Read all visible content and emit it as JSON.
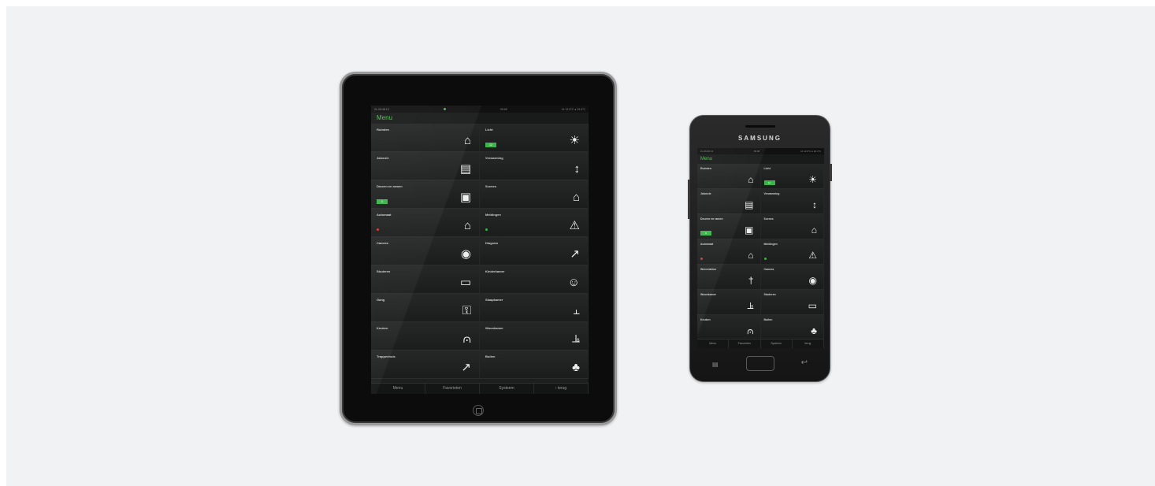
{
  "ipad": {
    "status": {
      "left": "Zo 09:48:13",
      "center": "09:48",
      "right": "14 12.9°C  ● 29.4°C"
    },
    "title": "Menu",
    "tiles": [
      {
        "label": "Ruimten",
        "icon": "house-icon",
        "glyph": "⌂"
      },
      {
        "label": "Licht",
        "icon": "sun-icon",
        "glyph": "☀",
        "badge": "12"
      },
      {
        "label": "Jaloezie",
        "icon": "blind-icon",
        "glyph": "▤"
      },
      {
        "label": "Verwarming",
        "icon": "thermometer-icon",
        "glyph": "↕"
      },
      {
        "label": "Deuren en ramen",
        "icon": "lock-icon",
        "glyph": "▣",
        "badge": "0"
      },
      {
        "label": "Scenes",
        "icon": "scene-house-icon",
        "glyph": "⌂"
      },
      {
        "label": "Automaat",
        "icon": "automation-icon",
        "glyph": "⌂",
        "led": "#d9362b"
      },
      {
        "label": "Meldingen",
        "icon": "warning-icon",
        "glyph": "⚠",
        "led": "#3bb54a"
      },
      {
        "label": "Camera",
        "icon": "eye-icon",
        "glyph": "◉"
      },
      {
        "label": "Diagram",
        "icon": "chart-icon",
        "glyph": "↗"
      },
      {
        "label": "Studeren",
        "icon": "monitor-icon",
        "glyph": "▭"
      },
      {
        "label": "Kinderkamer",
        "icon": "child-icon",
        "glyph": "☺"
      },
      {
        "label": "Gang",
        "icon": "key-icon",
        "glyph": "⚿"
      },
      {
        "label": "Slaapkamer",
        "icon": "bed-icon",
        "glyph": "⫠"
      },
      {
        "label": "Keuken",
        "icon": "pot-icon",
        "glyph": "⩀"
      },
      {
        "label": "Woonkamer",
        "icon": "sofa-icon",
        "glyph": "⫡"
      },
      {
        "label": "Trappenhuis",
        "icon": "stairs-icon",
        "glyph": "↗"
      },
      {
        "label": "Buiten",
        "icon": "garden-icon",
        "glyph": "♣"
      }
    ],
    "tabs": [
      "Menu",
      "Favorieten",
      "Systeem",
      "‹ terug"
    ]
  },
  "phone": {
    "brand": "SAMSUNG",
    "status": {
      "left": "Zo 09:48:13",
      "center": "09:48",
      "right": "14 12.9°C  ● 29.4°C"
    },
    "title": "Menu",
    "tiles": [
      {
        "label": "Ruimten",
        "icon": "house-icon",
        "glyph": "⌂"
      },
      {
        "label": "Licht",
        "icon": "sun-icon",
        "glyph": "☀",
        "badge": "12"
      },
      {
        "label": "Jaloezie",
        "icon": "blind-icon",
        "glyph": "▤"
      },
      {
        "label": "Verwarming",
        "icon": "thermometer-icon",
        "glyph": "↕"
      },
      {
        "label": "Deuren en ramen",
        "icon": "lock-icon",
        "glyph": "▣",
        "badge": "0"
      },
      {
        "label": "Scenes",
        "icon": "scene-house-icon",
        "glyph": "⌂"
      },
      {
        "label": "Automaat",
        "icon": "automation-icon",
        "glyph": "⌂",
        "led": "#d9362b"
      },
      {
        "label": "Meldingen",
        "icon": "warning-icon",
        "glyph": "⚠",
        "led": "#3bb54a"
      },
      {
        "label": "Weerstation",
        "icon": "weather-station-icon",
        "glyph": "†"
      },
      {
        "label": "Camera",
        "icon": "eye-icon",
        "glyph": "◉"
      },
      {
        "label": "Woonkamer",
        "icon": "sofa-icon",
        "glyph": "⫡"
      },
      {
        "label": "Studeren",
        "icon": "monitor-icon",
        "glyph": "▭"
      },
      {
        "label": "Keuken",
        "icon": "pot-icon",
        "glyph": "⩀"
      },
      {
        "label": "Buiten",
        "icon": "garden-icon",
        "glyph": "♣"
      }
    ],
    "tabs": [
      "Menu",
      "Favorieten",
      "Systeem",
      "terug"
    ]
  },
  "colors": {
    "accent": "#4cc24a",
    "badge": "#3bb54a",
    "led_red": "#d9362b",
    "background": "#f1f2f4"
  }
}
